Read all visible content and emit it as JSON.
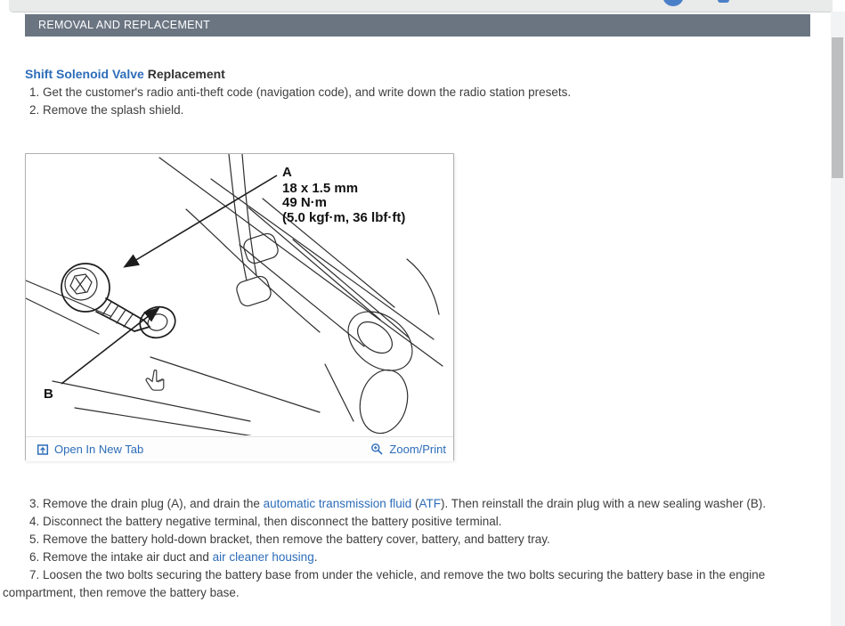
{
  "page": {
    "section_header": "REMOVAL AND REPLACEMENT",
    "title_link": "Shift Solenoid Valve",
    "title_rest": "Replacement"
  },
  "procedure": {
    "steps_before_figure": [
      {
        "number": "1.",
        "parts": [
          {
            "text": "Get the customer's radio anti-theft code (navigation code), and write down the radio station presets."
          }
        ]
      },
      {
        "number": "2.",
        "parts": [
          {
            "text": "Remove the splash shield."
          }
        ]
      }
    ],
    "steps_after_figure": [
      {
        "number": "3.",
        "parts": [
          {
            "text": "Remove the drain plug (A), and drain the "
          },
          {
            "text": "automatic transmission fluid",
            "link": true
          },
          {
            "text": " ("
          },
          {
            "text": "ATF",
            "link": true
          },
          {
            "text": "). Then reinstall the drain plug with a new sealing washer (B)."
          }
        ]
      },
      {
        "number": "4.",
        "parts": [
          {
            "text": "Disconnect the battery negative terminal, then disconnect the battery positive terminal."
          }
        ]
      },
      {
        "number": "5.",
        "parts": [
          {
            "text": "Remove the battery hold-down bracket, then remove the battery cover, battery, and battery tray."
          }
        ]
      },
      {
        "number": "6.",
        "parts": [
          {
            "text": "Remove the intake air duct and "
          },
          {
            "text": "air cleaner housing",
            "link": true
          },
          {
            "text": "."
          }
        ]
      },
      {
        "number": "7.",
        "parts": [
          {
            "text": "Loosen the two bolts securing the battery base from under the vehicle, and remove the two bolts securing the battery base in the engine compartment, then remove the battery base."
          }
        ]
      }
    ]
  },
  "figure": {
    "label_a": "A",
    "spec_line1": "18 x 1.5 mm",
    "spec_line2": "49 N·m",
    "spec_line3": "(5.0 kgf·m, 36 lbf·ft)",
    "label_b": "B",
    "open_in_new_tab_label": "Open In New Tab",
    "zoom_print_label": "Zoom/Print"
  },
  "icons": {
    "open_in_new_tab": "open-in-new-tab-icon",
    "zoom": "magnifier-plus-icon",
    "cursor": "hand-cursor-icon"
  },
  "colors": {
    "accent_blue": "#2d6db9",
    "section_bar_bg": "#6b7582",
    "body_text": "#3d3d3d",
    "scroll_thumb": "#bdbec0",
    "toolbar_fragment_blue": "#4b80c8"
  }
}
